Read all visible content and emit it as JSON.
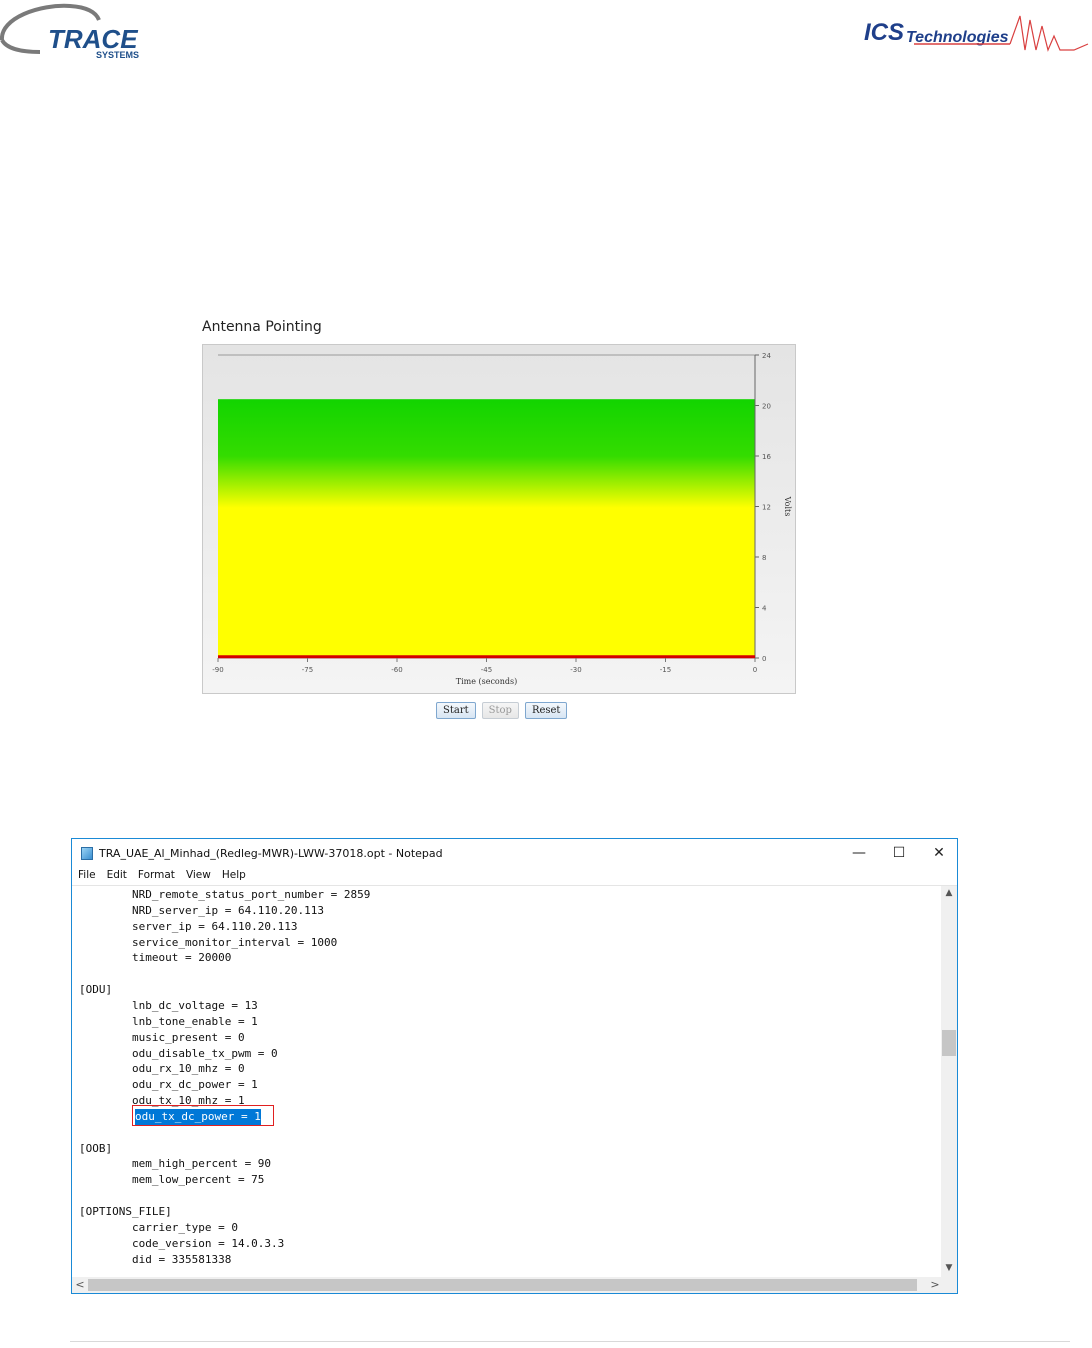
{
  "logos": {
    "trace_word": "TRACE",
    "trace_sub": "SYSTEMS",
    "ics_bold": "ICS",
    "ics_rest": "Technologies"
  },
  "antenna": {
    "title": "Antenna Pointing",
    "buttons": {
      "start": "Start",
      "stop": "Stop",
      "reset": "Reset"
    }
  },
  "chart_data": {
    "type": "area",
    "title": "",
    "xlabel": "Time (seconds)",
    "ylabel": "Volts",
    "x_ticks": [
      "-90",
      "-75",
      "-60",
      "-45",
      "-30",
      "-15",
      "0"
    ],
    "y_ticks": [
      "0",
      "4",
      "8",
      "12",
      "16",
      "20",
      "24"
    ],
    "xlim": [
      -90,
      0
    ],
    "ylim": [
      0,
      24
    ],
    "gauge_band": {
      "top": 20.5,
      "colors": [
        "#12d400",
        "#ffff00"
      ]
    },
    "series": [
      {
        "x": [
          -90,
          0
        ],
        "y": [
          0.1,
          0.1
        ],
        "color": "#d40000"
      }
    ]
  },
  "notepad": {
    "title": "TRA_UAE_Al_Minhad_(Redleg-MWR)-LWW-37018.opt - Notepad",
    "window_buttons": {
      "minimize": "—",
      "maximize": "☐",
      "close": "✕"
    },
    "menu": [
      "File",
      "Edit",
      "Format",
      "View",
      "Help"
    ],
    "lines": [
      "        NRD_remote_status_port_number = 2859",
      "        NRD_server_ip = 64.110.20.113",
      "        server_ip = 64.110.20.113",
      "        service_monitor_interval = 1000",
      "        timeout = 20000",
      "",
      "[ODU]",
      "        lnb_dc_voltage = 13",
      "        lnb_tone_enable = 1",
      "        music_present = 0",
      "        odu_disable_tx_pwm = 0",
      "        odu_rx_10_mhz = 0",
      "        odu_rx_dc_power = 1",
      "        odu_tx_10_mhz = 1",
      "        ",
      "",
      "[OOB]",
      "        mem_high_percent = 90",
      "        mem_low_percent = 75",
      "",
      "[OPTIONS_FILE]",
      "        carrier_type = 0",
      "        code_version = 14.0.3.3",
      "        did = 335581338"
    ],
    "selected_text": "odu_tx_dc_power = 1",
    "scroll": {
      "up": "▲",
      "down": "▼",
      "left": "<",
      "right": ">"
    }
  }
}
